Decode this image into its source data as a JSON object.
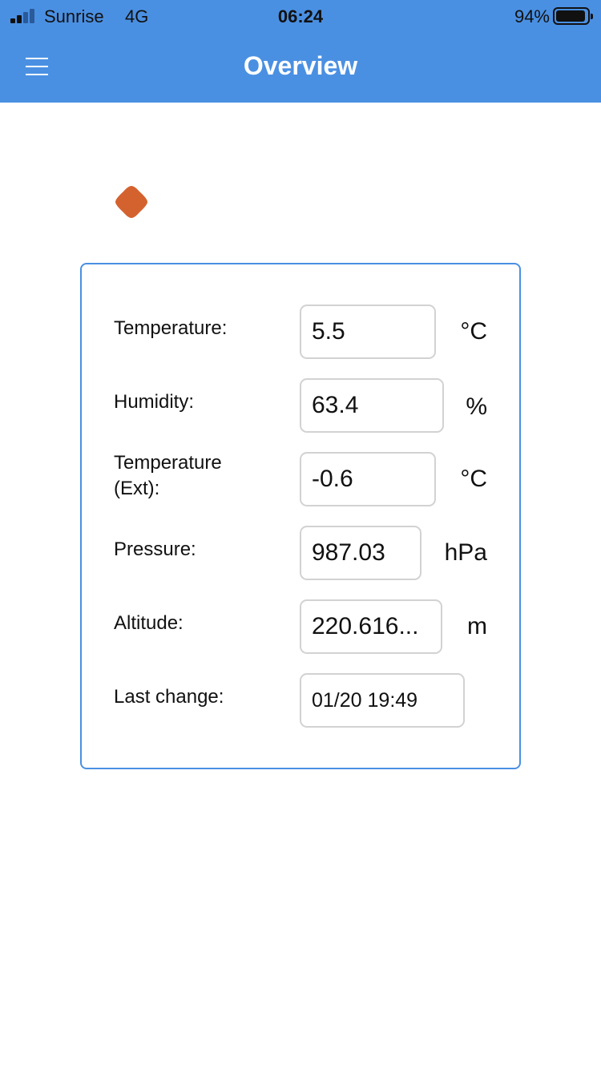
{
  "status_bar": {
    "carrier": "Sunrise",
    "network": "4G",
    "time": "06:24",
    "battery_percent": "94%",
    "battery_level": 0.94,
    "signal_bars_filled": 2,
    "signal_bars_total": 4
  },
  "navbar": {
    "title": "Overview",
    "menu_icon": "hamburger-menu-icon"
  },
  "status_indicator": {
    "icon": "status-diamond-icon",
    "color": "#d4622f"
  },
  "colors": {
    "accent": "#4a90e2"
  },
  "readings": [
    {
      "label": "Temperature:",
      "value": "5.5",
      "unit": "°C"
    },
    {
      "label": "Humidity:",
      "value": "63.4",
      "unit": "%"
    },
    {
      "label": "Temperature\n(Ext):",
      "value": "-0.6",
      "unit": "°C"
    },
    {
      "label": "Pressure:",
      "value": "987.03",
      "unit": "hPa"
    },
    {
      "label": "Altitude:",
      "value": "220.616...",
      "unit": "m"
    },
    {
      "label": "Last change:",
      "value": "01/20 19:49",
      "unit": ""
    }
  ]
}
